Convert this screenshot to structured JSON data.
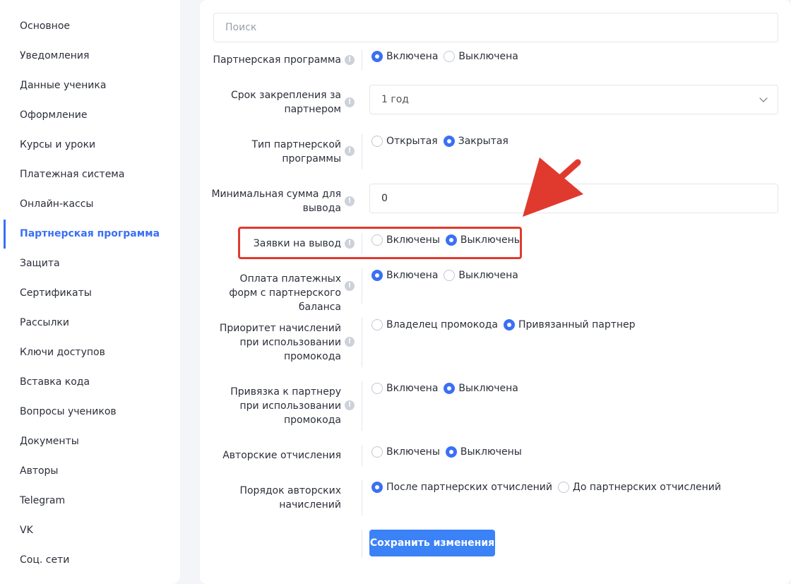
{
  "sidebar": {
    "items": [
      {
        "label": "Основное"
      },
      {
        "label": "Уведомления"
      },
      {
        "label": "Данные ученика"
      },
      {
        "label": "Оформление"
      },
      {
        "label": "Курсы и уроки"
      },
      {
        "label": "Платежная система"
      },
      {
        "label": "Онлайн-кассы"
      },
      {
        "label": "Партнерская программа",
        "active": true
      },
      {
        "label": "Защита"
      },
      {
        "label": "Сертификаты"
      },
      {
        "label": "Рассылки"
      },
      {
        "label": "Ключи доступов"
      },
      {
        "label": "Вставка кода"
      },
      {
        "label": "Вопросы учеников"
      },
      {
        "label": "Документы"
      },
      {
        "label": "Авторы"
      },
      {
        "label": "Telegram"
      },
      {
        "label": "VK"
      },
      {
        "label": "Соц. сети"
      }
    ]
  },
  "search": {
    "placeholder": "Поиск"
  },
  "settings": {
    "partner_program": {
      "label": "Партнерская программа",
      "options": [
        "Включена",
        "Выключена"
      ],
      "selected": "Включена"
    },
    "binding_term": {
      "label": "Срок закрепления за партнером",
      "value": "1 год"
    },
    "program_type": {
      "label": "Тип партнерской программы",
      "options": [
        "Открытая",
        "Закрытая"
      ],
      "selected": "Закрытая"
    },
    "min_withdraw": {
      "label": "Минимальная сумма для вывода",
      "value": "0"
    },
    "withdraw_requests": {
      "label": "Заявки на вывод",
      "options": [
        "Включены",
        "Выключены"
      ],
      "selected": "Выключены"
    },
    "payment_from_balance": {
      "label": "Оплата платежных форм с партнерского баланса",
      "options": [
        "Включена",
        "Выключена"
      ],
      "selected": "Включена"
    },
    "accrual_priority": {
      "label": "Приоритет начислений при использовании промокода",
      "options": [
        "Владелец промокода",
        "Привязанный партнер"
      ],
      "selected": "Привязанный партнер"
    },
    "promo_binding": {
      "label": "Привязка к партнеру при использовании промокода",
      "options": [
        "Включена",
        "Выключена"
      ],
      "selected": "Выключена"
    },
    "author_fees": {
      "label": "Авторские отчисления",
      "options": [
        "Включены",
        "Выключены"
      ],
      "selected": "Выключены"
    },
    "author_order": {
      "label": "Порядок авторских начислений",
      "options": [
        "После партнерских отчислений",
        "До партнерских отчислений"
      ],
      "selected": "После партнерских отчислений"
    }
  },
  "save_button": {
    "label": "Сохранить изменения"
  },
  "icons": {
    "info": "info-icon",
    "chevron": "chevron-down-icon"
  },
  "colors": {
    "accent": "#3b6ff5",
    "annotation": "#e03a2f"
  }
}
